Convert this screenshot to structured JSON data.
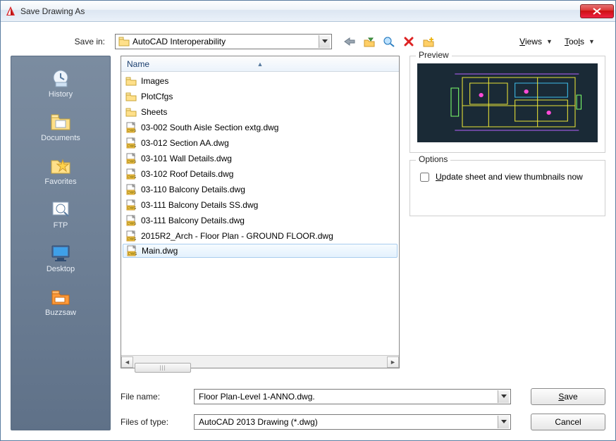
{
  "window": {
    "title": "Save Drawing As"
  },
  "savein": {
    "label": "Save in:",
    "folder": "AutoCAD Interoperability"
  },
  "menus": {
    "views": "Views",
    "tools": "Tools"
  },
  "places": [
    {
      "label": "History",
      "icon": "history"
    },
    {
      "label": "Documents",
      "icon": "documents"
    },
    {
      "label": "Favorites",
      "icon": "favorites"
    },
    {
      "label": "FTP",
      "icon": "ftp"
    },
    {
      "label": "Desktop",
      "icon": "desktop"
    },
    {
      "label": "Buzzsaw",
      "icon": "buzzsaw"
    }
  ],
  "filelist": {
    "header": "Name",
    "rows": [
      {
        "name": "Images",
        "type": "folder",
        "selected": false
      },
      {
        "name": "PlotCfgs",
        "type": "folder",
        "selected": false
      },
      {
        "name": "Sheets",
        "type": "folder",
        "selected": false
      },
      {
        "name": "03-002 South Aisle Section extg.dwg",
        "type": "dwg",
        "selected": false
      },
      {
        "name": "03-012 Section AA.dwg",
        "type": "dwg",
        "selected": false
      },
      {
        "name": "03-101 Wall Details.dwg",
        "type": "dwg",
        "selected": false
      },
      {
        "name": "03-102 Roof Details.dwg",
        "type": "dwg",
        "selected": false
      },
      {
        "name": "03-110 Balcony Details.dwg",
        "type": "dwg",
        "selected": false
      },
      {
        "name": "03-111 Balcony Details SS.dwg",
        "type": "dwg",
        "selected": false
      },
      {
        "name": "03-111 Balcony Details.dwg",
        "type": "dwg",
        "selected": false
      },
      {
        "name": "2015R2_Arch - Floor Plan - GROUND FLOOR.dwg",
        "type": "dwg",
        "selected": false
      },
      {
        "name": "Main.dwg",
        "type": "dwg",
        "selected": true
      }
    ]
  },
  "preview": {
    "title": "Preview"
  },
  "options": {
    "title": "Options",
    "checkbox_label": "Update sheet and view thumbnails now",
    "checkbox_checked": false
  },
  "filename": {
    "label": "File name:",
    "value": "Floor Plan-Level 1-ANNO.dwg."
  },
  "filetype": {
    "label": "Files of type:",
    "value": "AutoCAD 2013 Drawing (*.dwg)"
  },
  "buttons": {
    "save": "Save",
    "cancel": "Cancel"
  }
}
